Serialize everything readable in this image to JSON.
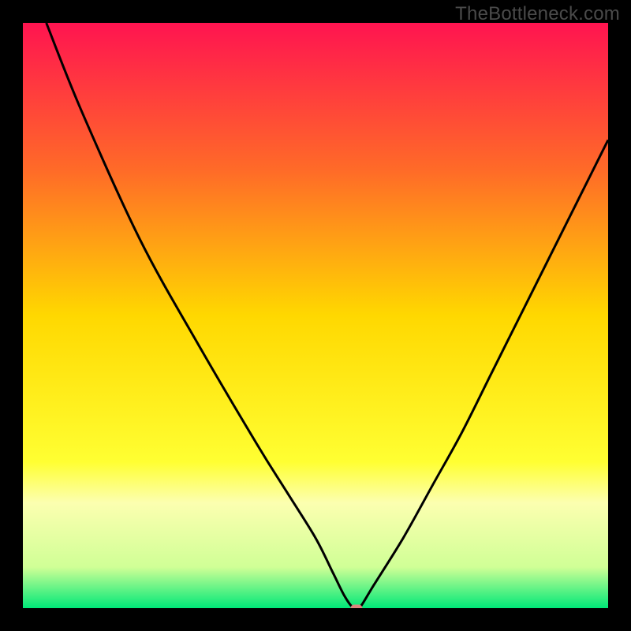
{
  "watermark": "TheBottleneck.com",
  "chart_data": {
    "type": "line",
    "title": "",
    "xlabel": "",
    "ylabel": "",
    "xlim": [
      0,
      100
    ],
    "ylim": [
      0,
      100
    ],
    "grid": false,
    "series": [
      {
        "name": "bottleneck-curve",
        "x": [
          4,
          10,
          20,
          30,
          40,
          45,
          50,
          53,
          55,
          56.5,
          57.5,
          60,
          65,
          70,
          75,
          80,
          85,
          90,
          95,
          100
        ],
        "y": [
          100,
          85,
          63,
          45,
          28,
          20,
          12,
          6,
          2,
          0,
          0,
          4,
          12,
          21,
          30,
          40,
          50,
          60,
          70,
          80
        ]
      }
    ],
    "marker": {
      "name": "optimal-point",
      "x": 57,
      "y": 0,
      "color": "#d9867d"
    },
    "gradient_stops": [
      {
        "offset": 0,
        "color": "#ff1450"
      },
      {
        "offset": 25,
        "color": "#ff6a28"
      },
      {
        "offset": 50,
        "color": "#ffd800"
      },
      {
        "offset": 75,
        "color": "#ffff32"
      },
      {
        "offset": 82,
        "color": "#fcffb0"
      },
      {
        "offset": 93,
        "color": "#d0ff96"
      },
      {
        "offset": 100,
        "color": "#00e878"
      }
    ]
  }
}
